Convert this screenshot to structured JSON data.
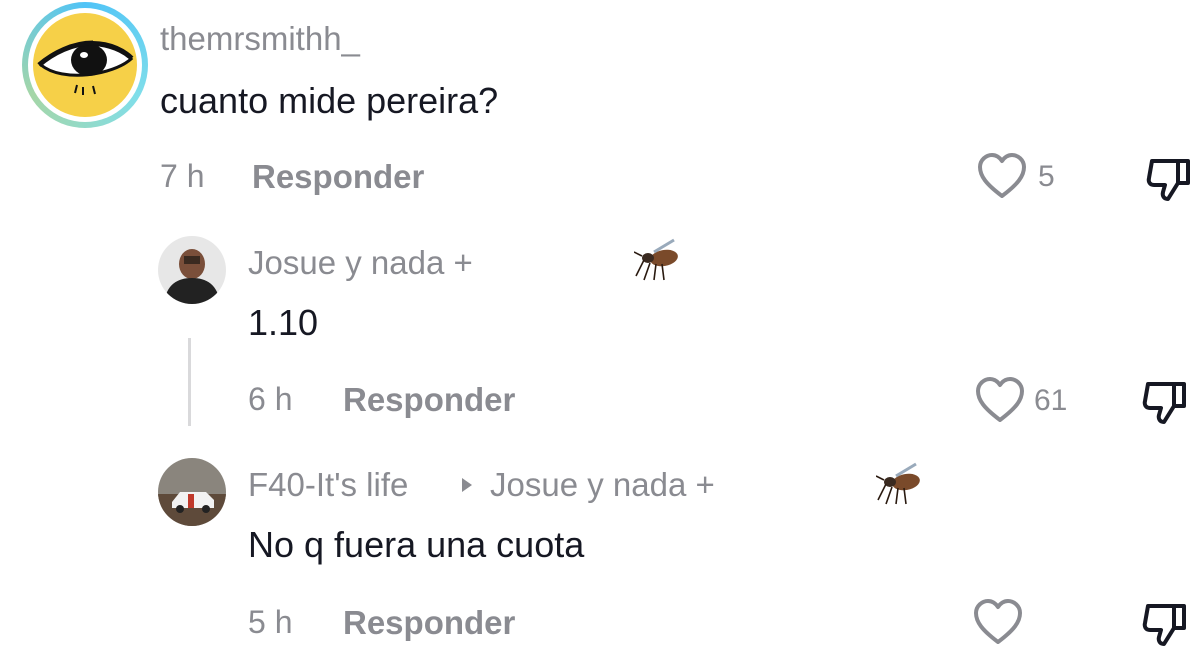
{
  "comments": [
    {
      "username": "themrsmithh_",
      "text": "cuanto mide pereira?",
      "time": "7 h",
      "reply_label": "Responder",
      "likes": "5",
      "avatar": "eye-illustration-icon"
    },
    {
      "username": "Josue y nada +",
      "text": "1.10",
      "time": "6 h",
      "reply_label": "Responder",
      "likes": "61",
      "badge": "mosquito-icon",
      "avatar": "person-photo"
    },
    {
      "username": "F40-It's life",
      "reply_to": "Josue y nada +",
      "text": "No q fuera una cuota",
      "time": "5 h",
      "reply_label": "Responder",
      "likes": "",
      "badge": "mosquito-icon",
      "avatar": "race-car-photo"
    }
  ],
  "icons": {
    "like": "heart-outline-icon",
    "dislike": "thumbs-down-icon"
  },
  "colors": {
    "text": "#161823",
    "muted": "#8a8b91",
    "avatar_yellow": "#f6d048"
  }
}
